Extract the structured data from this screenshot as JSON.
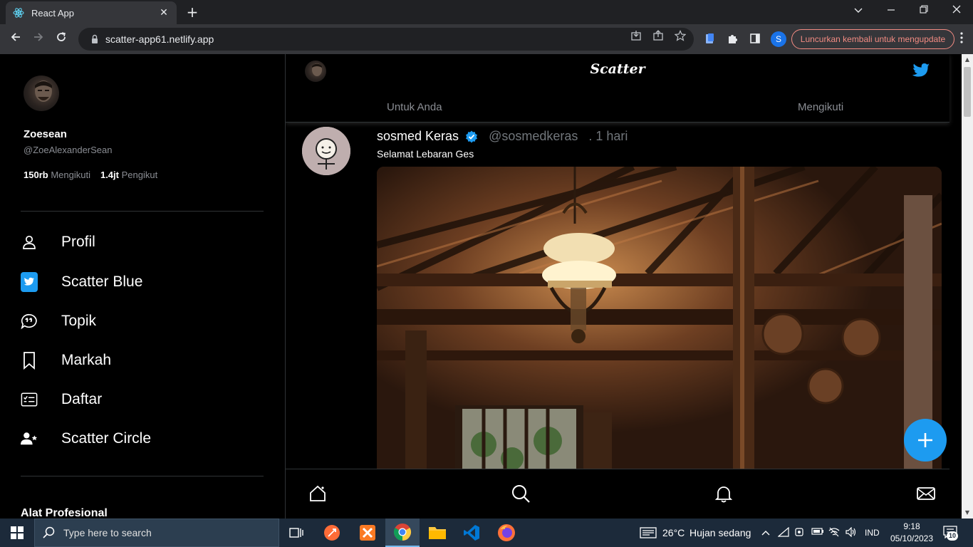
{
  "browser": {
    "tab_title": "React App",
    "tab_close": "✕",
    "new_tab": "+",
    "url": "scatter-app61.netlify.app",
    "profile_initial": "S",
    "update_button": "Luncurkan kembali untuk mengupdate",
    "window_controls": [
      "minimize",
      "restore",
      "close"
    ]
  },
  "sidebar": {
    "name": "Zoesean",
    "handle": "@ZoeAlexanderSean",
    "following_count": "150rb",
    "following_label": "Mengikuti",
    "followers_count": "1.4jt",
    "followers_label": "Pengikut",
    "nav": [
      {
        "label": "Profil",
        "icon": "person-icon"
      },
      {
        "label": "Scatter Blue",
        "icon": "twitter-blue-icon"
      },
      {
        "label": "Topik",
        "icon": "topic-bubble-icon"
      },
      {
        "label": "Markah",
        "icon": "bookmark-icon"
      },
      {
        "label": "Daftar",
        "icon": "list-icon"
      },
      {
        "label": "Scatter Circle",
        "icon": "circle-people-icon"
      }
    ],
    "section_title": "Alat Profesional"
  },
  "header": {
    "logo": "Scatter",
    "tab_for_you": "Untuk Anda",
    "tab_following": "Mengikuti"
  },
  "post": {
    "name": "sosmed Keras",
    "handle": "@sosmedkeras",
    "time": ". 1 hari",
    "text": "Selamat Lebaran Ges"
  },
  "taskbar": {
    "search_placeholder": "Type here to search",
    "weather_temp": "26°C",
    "weather_desc": "Hujan sedang",
    "lang": "IND",
    "time": "9:18",
    "date": "05/10/2023",
    "notifications": "10"
  },
  "colors": {
    "accent": "#1d9bf0",
    "background": "#000000",
    "muted": "#8a8d93",
    "update_red": "#f28b82"
  }
}
